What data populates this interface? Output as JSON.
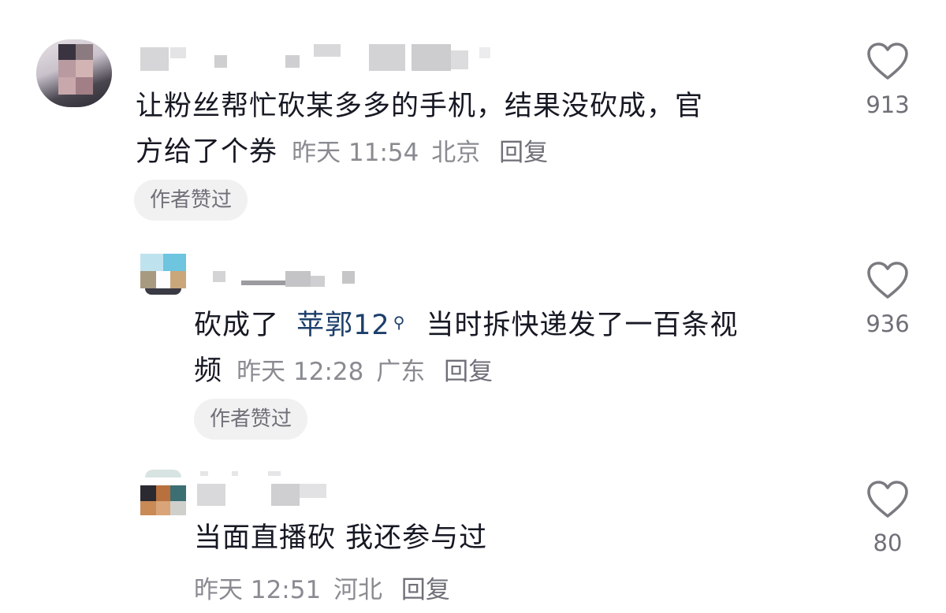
{
  "comments": [
    {
      "text": "让粉丝帮忙砍某多多的手机，结果没砍成，官方给了个券",
      "text_line1": "让粉丝帮忙砍某多多的手机，结果没砍成，官",
      "text_line2": "方给了个券",
      "time": "昨天 11:54",
      "location": "北京",
      "reply_label": "回复",
      "badge": "作者赞过",
      "likes": "913"
    },
    {
      "text_before_mention": "砍成了",
      "mention": "苹郭12",
      "mention_icon": "search-icon",
      "text_after_mention_line1": "当时拆快递发了一百条视",
      "text_line2": "频",
      "time": "昨天 12:28",
      "location": "广东",
      "reply_label": "回复",
      "badge": "作者赞过",
      "likes": "936"
    },
    {
      "text": "当面直播砍 我还参与过",
      "time": "昨天 12:51",
      "location": "河北",
      "reply_label": "回复",
      "likes": "80"
    }
  ],
  "colors": {
    "text": "#161823",
    "meta": "#8a8b91",
    "mention": "#1d3f6b",
    "badge_bg": "#f1f1f2",
    "heart_stroke": "#7a7b80"
  },
  "icons": {
    "like": "heart-outline-icon"
  }
}
